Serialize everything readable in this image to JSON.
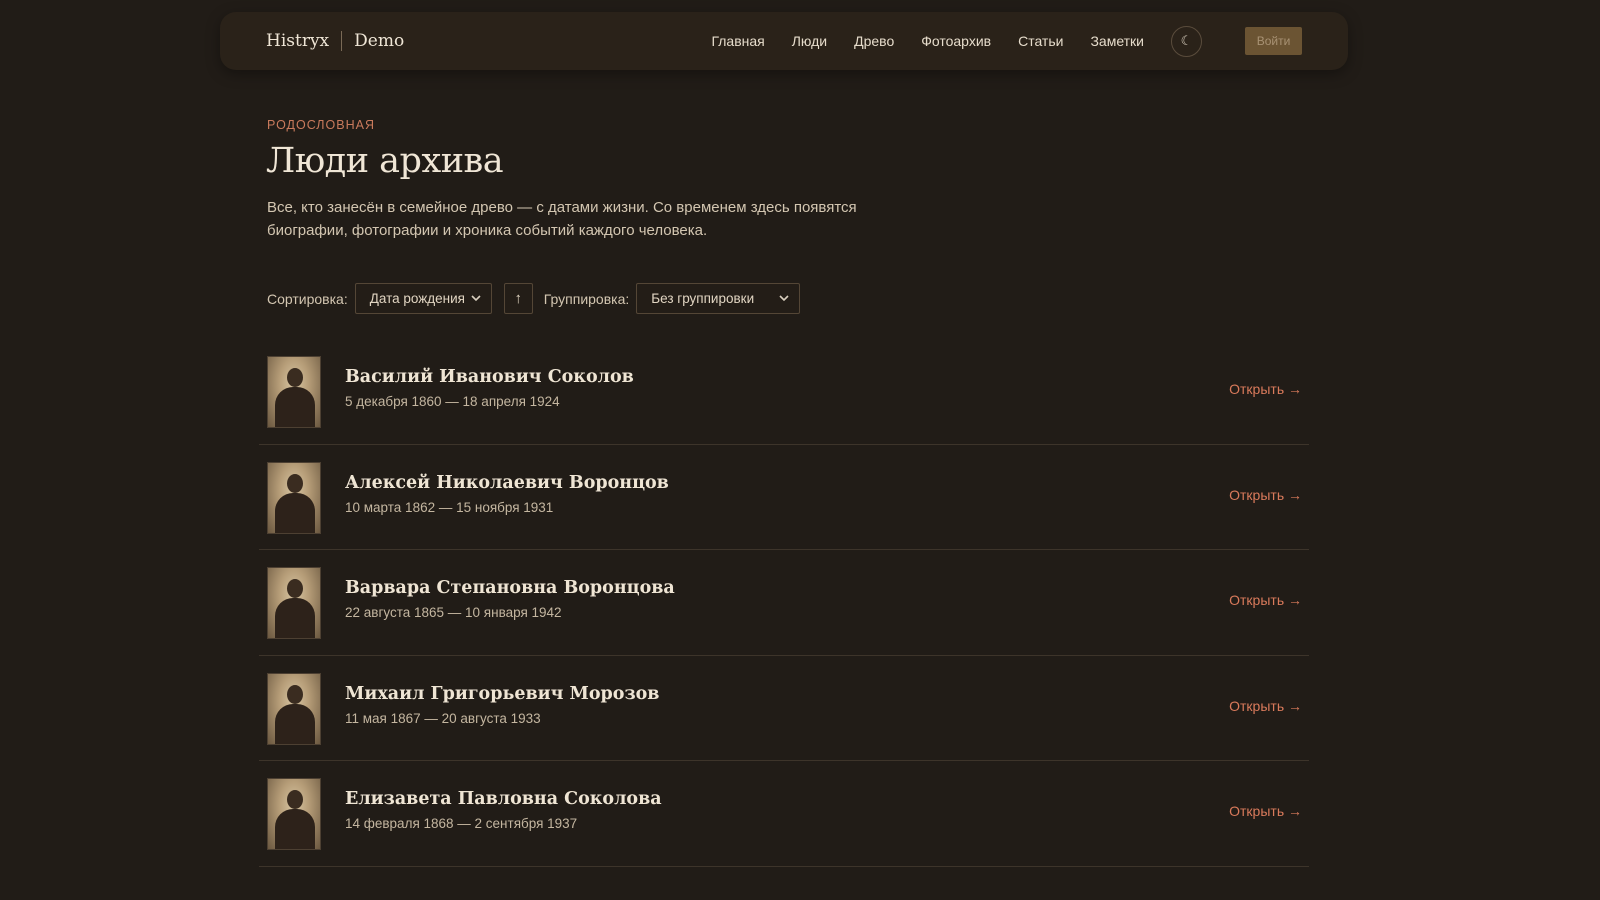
{
  "header": {
    "brand": "Histryx",
    "brand_suffix": "Demo",
    "nav": [
      "Главная",
      "Люди",
      "Древо",
      "Фотоархив",
      "Статьи",
      "Заметки"
    ],
    "theme_icon": "moon-icon",
    "theme_glyph": "☾",
    "login_label": "Войти"
  },
  "page": {
    "eyebrow": "РОДОСЛОВНАЯ",
    "title": "Люди архива",
    "description": "Все, кто занесён в семейное древо — с датами жизни. Со временем здесь появятся биографии, фотографии и хроника событий каждого человека."
  },
  "controls": {
    "sort_label": "Сортировка:",
    "sort_value": "Дата рождения",
    "sort_direction": "↑",
    "group_label": "Группировка:",
    "group_value": "Без группировки"
  },
  "people": [
    {
      "name": "Василий Иванович Соколов",
      "dates": "5 декабря 1860 — 18 апреля 1924",
      "action": "Открыть →"
    },
    {
      "name": "Алексей Николаевич Воронцов",
      "dates": "10 марта 1862 — 15 ноября 1931",
      "action": "Открыть →"
    },
    {
      "name": "Варвара Степановна Воронцова",
      "dates": "22 августа 1865 — 10 января 1942",
      "action": "Открыть →"
    },
    {
      "name": "Михаил Григорьевич Морозов",
      "dates": "11 мая 1867 — 20 августа 1933",
      "action": "Открыть →"
    },
    {
      "name": "Елизавета Павловна Соколова",
      "dates": "14 февраля 1868 — 2 сентября 1937",
      "action": "Открыть →"
    }
  ],
  "colors": {
    "background": "#211c17",
    "header": "#2a2219",
    "accent": "#d97a5b",
    "login_button": "#6b5433"
  }
}
